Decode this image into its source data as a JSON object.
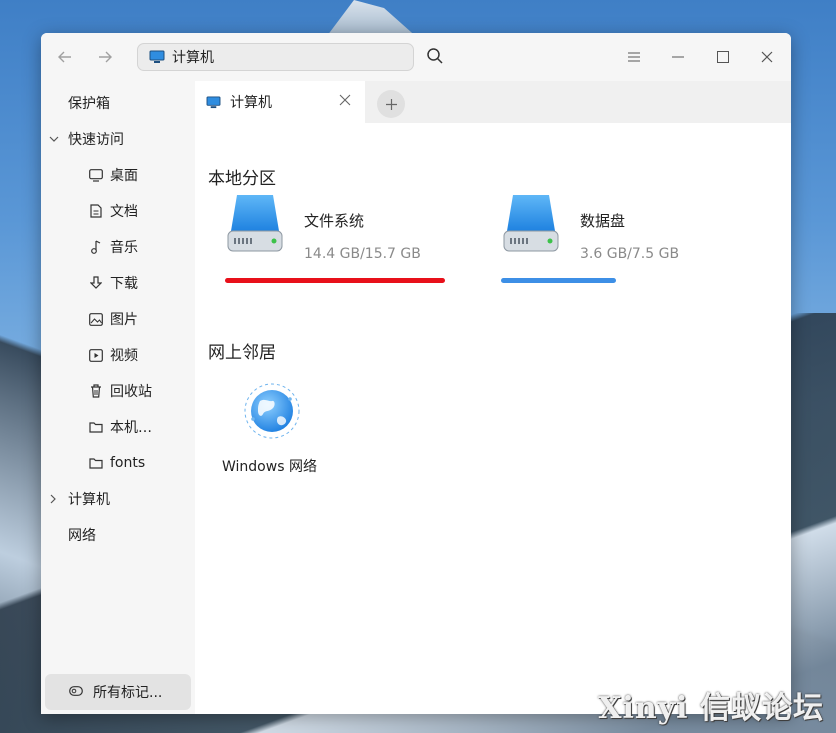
{
  "window": {
    "address": "计算机"
  },
  "sidebar": {
    "items": [
      {
        "label": "保护箱"
      },
      {
        "label": "快速访问"
      },
      {
        "label": "桌面"
      },
      {
        "label": "文档"
      },
      {
        "label": "音乐"
      },
      {
        "label": "下载"
      },
      {
        "label": "图片"
      },
      {
        "label": "视频"
      },
      {
        "label": "回收站"
      },
      {
        "label": "本机…"
      },
      {
        "label": "fonts"
      },
      {
        "label": "计算机"
      },
      {
        "label": "网络"
      }
    ],
    "tags_button": "所有标记..."
  },
  "tabs": [
    {
      "label": "计算机"
    }
  ],
  "main": {
    "local_section": "本地分区",
    "disks": [
      {
        "name": "文件系统",
        "usage": "14.4 GB/15.7 GB",
        "used_fraction": 0.917,
        "bar_color": "#e8101a"
      },
      {
        "name": "数据盘",
        "usage": "3.6 GB/7.5 GB",
        "used_fraction": 0.48,
        "bar_color": "#3d8fe6"
      }
    ],
    "network_section": "网上邻居",
    "network_items": [
      {
        "label": "Windows 网络"
      }
    ]
  },
  "watermark": "Xinyi 信蚁论坛"
}
